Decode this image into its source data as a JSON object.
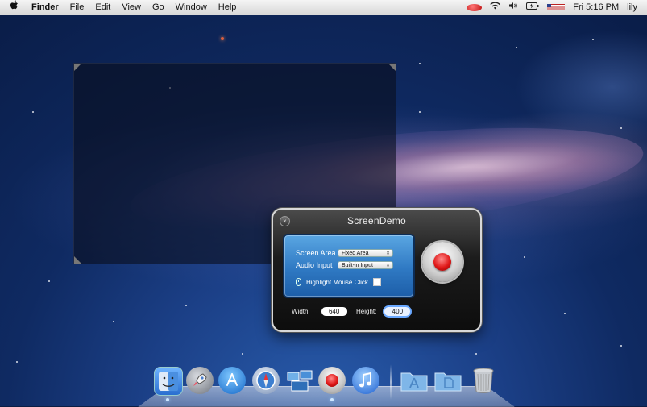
{
  "menubar": {
    "apple_icon": "",
    "app_name": "Finder",
    "menus": [
      "File",
      "Edit",
      "View",
      "Go",
      "Window",
      "Help"
    ],
    "status": {
      "recording_indicator": "rec-dot",
      "wifi_icon": "wifi-icon",
      "volume_icon": "volume-icon",
      "battery_icon": "battery-icon",
      "flag_icon": "us-flag-icon",
      "clock": "Fri 5:16 PM",
      "user": "lily"
    }
  },
  "screendemo": {
    "title": "ScreenDemo",
    "screen_area_label": "Screen Area",
    "screen_area_value": "Fixed Area",
    "audio_input_label": "Audio Input",
    "audio_input_value": "Built-in Input",
    "highlight_label": "Highlight Mouse Click",
    "highlight_checked": false,
    "width_label": "Width:",
    "width_value": "640",
    "height_label": "Height:",
    "height_value": "400",
    "accent": "#2f79c3",
    "record_color": "#e01818"
  },
  "dock": {
    "items": [
      {
        "name": "finder",
        "icon": "finder-icon",
        "color": "#4a8fe0",
        "running": true
      },
      {
        "name": "launchpad",
        "icon": "rocket-icon",
        "color": "#8a8f98",
        "running": false
      },
      {
        "name": "app-store",
        "icon": "app-store-icon",
        "color": "#2b8fe8",
        "running": false
      },
      {
        "name": "safari",
        "icon": "compass-icon",
        "color": "#3d7fd0",
        "running": false
      },
      {
        "name": "mission-control",
        "icon": "mission-control-icon",
        "color": "#5aa0d8",
        "running": false
      },
      {
        "name": "screendemo",
        "icon": "record-icon",
        "color": "#d21a1a",
        "running": true
      },
      {
        "name": "itunes",
        "icon": "music-note-icon",
        "color": "#2a6fe0",
        "running": false
      }
    ],
    "stacks": [
      {
        "name": "applications",
        "icon": "applications-folder-icon",
        "color": "#7fb6e8"
      },
      {
        "name": "documents",
        "icon": "documents-folder-icon",
        "color": "#7fb6e8"
      },
      {
        "name": "trash",
        "icon": "trash-icon",
        "color": "#c9ccd1"
      }
    ]
  }
}
